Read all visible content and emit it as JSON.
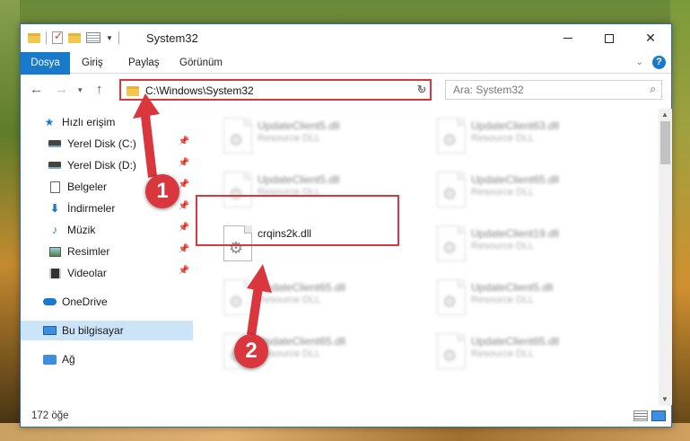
{
  "window": {
    "title": "System32"
  },
  "ribbon": {
    "tabs": [
      "Dosya",
      "Giriş",
      "Paylaş",
      "Görünüm"
    ]
  },
  "address": {
    "path": "C:\\Windows\\System32"
  },
  "search": {
    "placeholder": "Ara: System32"
  },
  "sidebar": {
    "items": [
      {
        "label": "Hızlı erişim",
        "icon": "star-icon"
      },
      {
        "label": "Yerel Disk (C:)",
        "icon": "drive-icon",
        "pinned": true
      },
      {
        "label": "Yerel Disk (D:)",
        "icon": "drive-icon",
        "pinned": true
      },
      {
        "label": "Belgeler",
        "icon": "document-icon",
        "pinned": true
      },
      {
        "label": "İndirmeler",
        "icon": "download-icon",
        "pinned": true
      },
      {
        "label": "Müzik",
        "icon": "music-icon",
        "pinned": true
      },
      {
        "label": "Resimler",
        "icon": "pictures-icon",
        "pinned": true
      },
      {
        "label": "Videolar",
        "icon": "video-icon",
        "pinned": true
      },
      {
        "label": "OneDrive",
        "icon": "cloud-icon"
      },
      {
        "label": "Bu bilgisayar",
        "icon": "computer-icon",
        "selected": true
      },
      {
        "label": "Ağ",
        "icon": "network-icon"
      }
    ]
  },
  "files": {
    "left": [
      {
        "name": "UpdateClient5.dll",
        "type": "Resource DLL"
      },
      {
        "name": "UpdateClient5.dll",
        "type": "Resource DLL"
      },
      {
        "name": "crqins2k.dll",
        "type": ""
      },
      {
        "name": "UpdateClient65.dll",
        "type": "Resource DLL"
      },
      {
        "name": "UpdateClient65.dll",
        "type": "Resource DLL"
      }
    ],
    "right": [
      {
        "name": "UpdateClient63.dll",
        "type": "Resource DLL"
      },
      {
        "name": "UpdateClient65.dll",
        "type": "Resource DLL"
      },
      {
        "name": "UpdateClient19.dll",
        "type": "Resource DLL"
      },
      {
        "name": "UpdateClient5.dll",
        "type": "Resource DLL"
      },
      {
        "name": "UpdateClient65.dll",
        "type": "Resource DLL"
      }
    ],
    "highlighted": "crqins2k.dll"
  },
  "status": {
    "count": "172 öğe"
  },
  "annotations": {
    "step1": "1",
    "step2": "2",
    "color": "#d9363e"
  }
}
